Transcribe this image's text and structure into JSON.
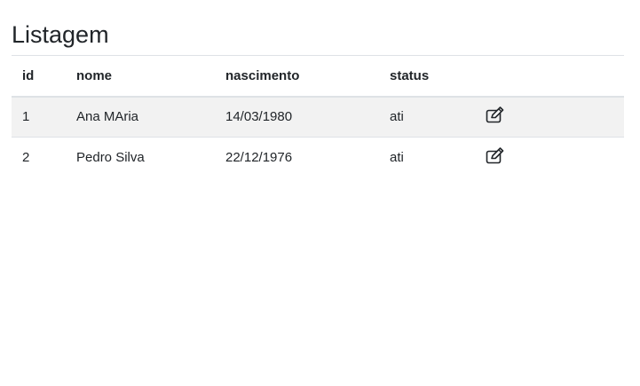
{
  "page": {
    "title": "Listagem"
  },
  "table": {
    "headers": {
      "id": "id",
      "nome": "nome",
      "nascimento": "nascimento",
      "status": "status",
      "action": ""
    },
    "rows": [
      {
        "id": "1",
        "nome": "Ana MAria",
        "nascimento": "14/03/1980",
        "status": "ati",
        "action_icon": "edit-icon"
      },
      {
        "id": "2",
        "nome": "Pedro Silva",
        "nascimento": "22/12/1976",
        "status": "ati",
        "action_icon": "edit-icon"
      }
    ]
  },
  "colors": {
    "text": "#212529",
    "border": "#dee2e6",
    "striped_row": "#f2f2f2"
  }
}
